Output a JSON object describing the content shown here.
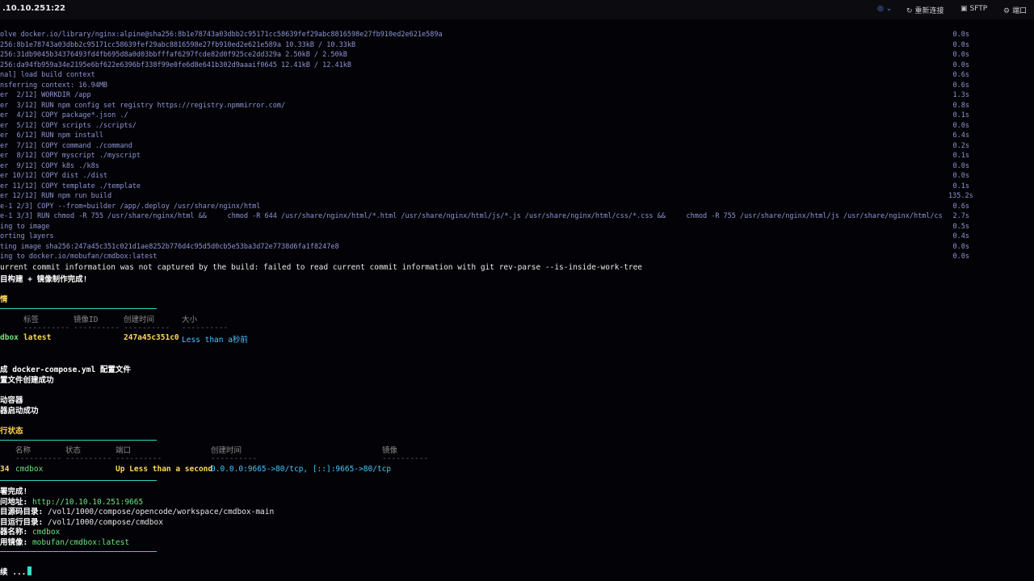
{
  "window": {
    "title": ".10.10.251:22",
    "toolbar": {
      "bulb_icon": "lightbulb-icon",
      "bulb_caret": "⌄",
      "reconnect": "重新连接",
      "sftp": "SFTP",
      "ports": "端口"
    }
  },
  "build_log": [
    {
      "text": "olve docker.io/library/nginx:alpine@sha256:8b1e78743a03dbb2c95171cc58639fef29abc8816598e27fb910ed2e621e589a",
      "time": "0.0s"
    },
    {
      "text": "256:8b1e78743a03dbb2c95171cc58639fef29abc8816598e27fb910ed2e621e589a 10.33kB / 10.33kB",
      "time": "0.0s"
    },
    {
      "text": "256:31db9045b34376493fd4fb695d8a0d03bbfffaf6297fcde82d0f925ce2dd329a 2.50kB / 2.50kB",
      "time": "0.0s"
    },
    {
      "text": "256:da94fb959a34e2195e6bf622e6396bf338f99e0fe6d8e641b302d9aaaif0645 12.41kB / 12.41kB",
      "time": "0.0s"
    },
    {
      "text": "nal] load build context",
      "time": "0.6s"
    },
    {
      "text": "nsferring context: 16.94MB",
      "time": "0.6s"
    },
    {
      "text": "er  2/12] WORKDIR /app",
      "time": "1.3s"
    },
    {
      "text": "er  3/12] RUN npm config set registry https://registry.npmmirror.com/",
      "time": "0.8s"
    },
    {
      "text": "er  4/12] COPY package*.json ./",
      "time": "0.1s"
    },
    {
      "text": "er  5/12] COPY scripts ./scripts/",
      "time": "0.0s"
    },
    {
      "text": "er  6/12] RUN npm install",
      "time": "6.4s"
    },
    {
      "text": "er  7/12] COPY command ./command",
      "time": "0.2s"
    },
    {
      "text": "er  8/12] COPY myscript ./myscript",
      "time": "0.1s"
    },
    {
      "text": "er  9/12] COPY k8s ./k8s",
      "time": "0.0s"
    },
    {
      "text": "er 10/12] COPY dist ./dist",
      "time": "0.0s"
    },
    {
      "text": "er 11/12] COPY template ./template",
      "time": "0.1s"
    },
    {
      "text": "er 12/12] RUN npm run build",
      "time": "135.2s"
    },
    {
      "text": "e-1 2/3] COPY --from=builder /app/.deploy /usr/share/nginx/html",
      "time": "0.6s"
    },
    {
      "text": "e-1 3/3] RUN chmod -R 755 /usr/share/nginx/html &&     chmod -R 644 /usr/share/nginx/html/*.html /usr/share/nginx/html/js/*.js /usr/share/nginx/html/css/*.css &&     chmod -R 755 /usr/share/nginx/html/js /usr/share/nginx/html/cs",
      "time": "2.7s"
    },
    {
      "text": "ing to image",
      "time": "0.5s"
    },
    {
      "text": "orting layers",
      "time": "0.4s"
    },
    {
      "text": "ting image sha256:247a45c351c021d1ae8252b776d4c95d5d0cb5e53ba3d72e7738d6fa1f8247e8",
      "time": "0.0s"
    },
    {
      "text": "ing to docker.io/mobufan/cmdbox:latest",
      "time": "0.0s"
    }
  ],
  "warning": "urrent commit information was not captured by the build: failed to read current commit information with git rev-parse --is-inside-work-tree",
  "build_done": "目构建 + 镜像制作完成!",
  "image_section": {
    "title": "情",
    "headers": [
      "标签",
      "镜像ID",
      "创建时间",
      "大小"
    ],
    "dashes": "----------",
    "row": {
      "repo": "dbox",
      "tag": "latest",
      "id": "247a45c351c0",
      "created": "Less than a秒前"
    }
  },
  "compose": {
    "line1": "成 docker-compose.yml 配置文件",
    "line2": "置文件创建成功"
  },
  "start": {
    "line1": "动容器",
    "line2": "器启动成功"
  },
  "status_section": {
    "title": "行状态",
    "headers": [
      "名称",
      "状态",
      "端口",
      "创建时间",
      "镜像"
    ],
    "dashes": "----------",
    "row": {
      "id": "34",
      "name": "cmdbox",
      "status": "Up Less than a second",
      "ports": "0.0.0.0:9665->80/tcp, [::]:9665->80/tcp"
    }
  },
  "summary": {
    "done": "署完成!",
    "url_label": "问地址: ",
    "url": "http://10.10.10.251:9665",
    "src_label": "目源码目录: ",
    "src": "/vol1/1000/compose/opencode/workspace/cmdbox-main",
    "run_label": "目运行目录: ",
    "run": "/vol1/1000/compose/cmdbox",
    "name_label": "器名称: ",
    "name": "cmdbox",
    "img_label": "用镜像: ",
    "img": "mobufan/cmdbox:latest"
  },
  "prompt": "续 ...",
  "colors": {
    "accent": "#2bd6c5",
    "time": "#8e95d6",
    "link": "#48c4ff",
    "green": "#6fe37d",
    "yellow": "#ffd75a"
  }
}
